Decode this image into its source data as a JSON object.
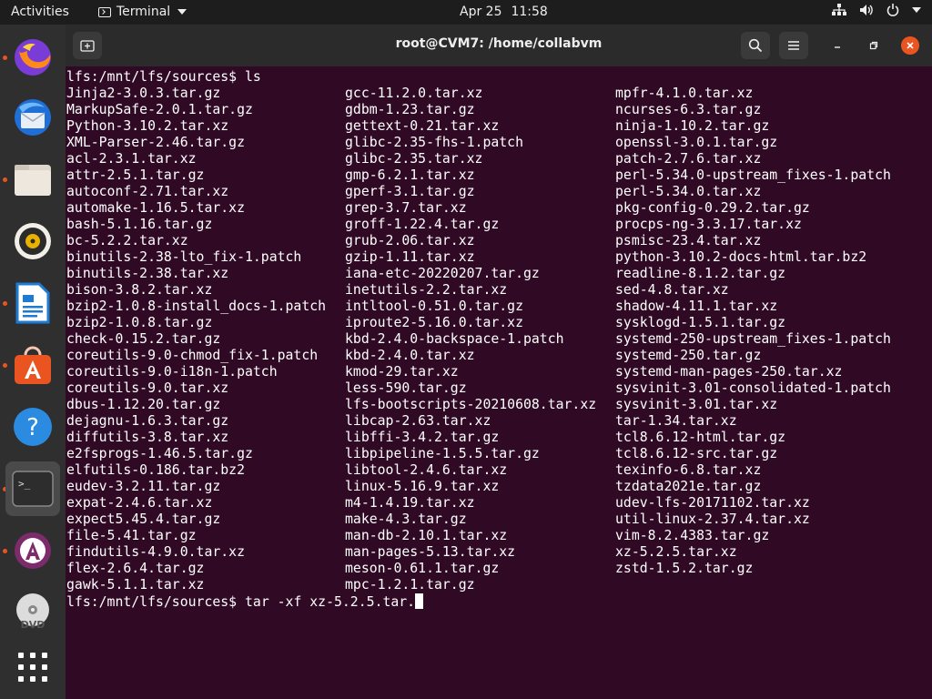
{
  "topbar": {
    "activities": "Activities",
    "app_name": "Terminal",
    "date": "Apr 25",
    "time": "11:58"
  },
  "dock": {
    "items": [
      "firefox-icon",
      "thunderbird-icon",
      "files-icon",
      "rhythmbox-icon",
      "libreoffice-writer-icon",
      "software-center-icon",
      "help-icon",
      "terminal-icon",
      "software-updater-icon",
      "dvd-icon",
      "show-apps-icon"
    ]
  },
  "window": {
    "title": "root@CVM7: /home/collabvm"
  },
  "terminal": {
    "cmd1": "lfs:/mnt/lfs/sources$ ls",
    "prompt2": "lfs:/mnt/lfs/sources$ ",
    "cmd2": "tar -xf xz-5.2.5.tar.",
    "col1": [
      "Jinja2-3.0.3.tar.gz",
      "MarkupSafe-2.0.1.tar.gz",
      "Python-3.10.2.tar.xz",
      "XML-Parser-2.46.tar.gz",
      "acl-2.3.1.tar.xz",
      "attr-2.5.1.tar.gz",
      "autoconf-2.71.tar.xz",
      "automake-1.16.5.tar.xz",
      "bash-5.1.16.tar.gz",
      "bc-5.2.2.tar.xz",
      "binutils-2.38-lto_fix-1.patch",
      "binutils-2.38.tar.xz",
      "bison-3.8.2.tar.xz",
      "bzip2-1.0.8-install_docs-1.patch",
      "bzip2-1.0.8.tar.gz",
      "check-0.15.2.tar.gz",
      "coreutils-9.0-chmod_fix-1.patch",
      "coreutils-9.0-i18n-1.patch",
      "coreutils-9.0.tar.xz",
      "dbus-1.12.20.tar.gz",
      "dejagnu-1.6.3.tar.gz",
      "diffutils-3.8.tar.xz",
      "e2fsprogs-1.46.5.tar.gz",
      "elfutils-0.186.tar.bz2",
      "eudev-3.2.11.tar.gz",
      "expat-2.4.6.tar.xz",
      "expect5.45.4.tar.gz",
      "file-5.41.tar.gz",
      "findutils-4.9.0.tar.xz",
      "flex-2.6.4.tar.gz",
      "gawk-5.1.1.tar.xz"
    ],
    "col2": [
      "gcc-11.2.0.tar.xz",
      "gdbm-1.23.tar.gz",
      "gettext-0.21.tar.xz",
      "glibc-2.35-fhs-1.patch",
      "glibc-2.35.tar.xz",
      "gmp-6.2.1.tar.xz",
      "gperf-3.1.tar.gz",
      "grep-3.7.tar.xz",
      "groff-1.22.4.tar.gz",
      "grub-2.06.tar.xz",
      "gzip-1.11.tar.xz",
      "iana-etc-20220207.tar.gz",
      "inetutils-2.2.tar.xz",
      "intltool-0.51.0.tar.gz",
      "iproute2-5.16.0.tar.xz",
      "kbd-2.4.0-backspace-1.patch",
      "kbd-2.4.0.tar.xz",
      "kmod-29.tar.xz",
      "less-590.tar.gz",
      "lfs-bootscripts-20210608.tar.xz",
      "libcap-2.63.tar.xz",
      "libffi-3.4.2.tar.gz",
      "libpipeline-1.5.5.tar.gz",
      "libtool-2.4.6.tar.xz",
      "linux-5.16.9.tar.xz",
      "m4-1.4.19.tar.xz",
      "make-4.3.tar.gz",
      "man-db-2.10.1.tar.xz",
      "man-pages-5.13.tar.xz",
      "meson-0.61.1.tar.gz",
      "mpc-1.2.1.tar.gz"
    ],
    "col3": [
      "mpfr-4.1.0.tar.xz",
      "ncurses-6.3.tar.gz",
      "ninja-1.10.2.tar.gz",
      "openssl-3.0.1.tar.gz",
      "patch-2.7.6.tar.xz",
      "perl-5.34.0-upstream_fixes-1.patch",
      "perl-5.34.0.tar.xz",
      "pkg-config-0.29.2.tar.gz",
      "procps-ng-3.3.17.tar.xz",
      "psmisc-23.4.tar.xz",
      "python-3.10.2-docs-html.tar.bz2",
      "readline-8.1.2.tar.gz",
      "sed-4.8.tar.xz",
      "shadow-4.11.1.tar.xz",
      "sysklogd-1.5.1.tar.gz",
      "systemd-250-upstream_fixes-1.patch",
      "systemd-250.tar.gz",
      "systemd-man-pages-250.tar.xz",
      "sysvinit-3.01-consolidated-1.patch",
      "sysvinit-3.01.tar.xz",
      "tar-1.34.tar.xz",
      "tcl8.6.12-html.tar.gz",
      "tcl8.6.12-src.tar.gz",
      "texinfo-6.8.tar.xz",
      "tzdata2021e.tar.gz",
      "udev-lfs-20171102.tar.xz",
      "util-linux-2.37.4.tar.xz",
      "vim-8.2.4383.tar.gz",
      "xz-5.2.5.tar.xz",
      "zstd-1.5.2.tar.gz"
    ]
  }
}
